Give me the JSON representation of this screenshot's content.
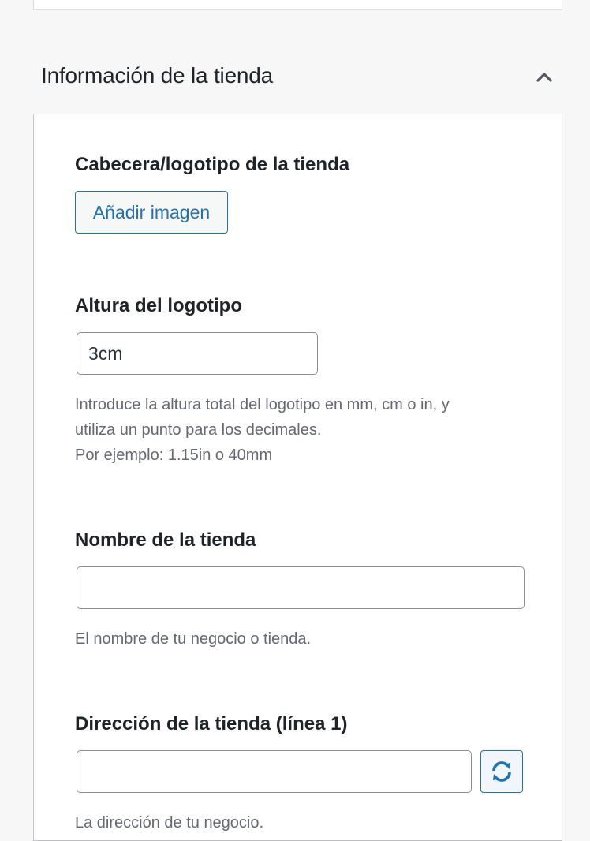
{
  "section": {
    "title": "Información de la tienda"
  },
  "fields": {
    "logo": {
      "label": "Cabecera/logotipo de la tienda",
      "button_label": "Añadir imagen"
    },
    "logo_height": {
      "label": "Altura del logotipo",
      "value": "3cm",
      "help_line1": "Introduce la altura total del logotipo en mm, cm o in, y",
      "help_line2": "utiliza un punto para los decimales.",
      "help_line3": "Por ejemplo: 1.15in o 40mm"
    },
    "shop_name": {
      "label": "Nombre de la tienda",
      "value": "",
      "help": "El nombre de tu negocio o tienda."
    },
    "shop_address_1": {
      "label": "Dirección de la tienda (línea 1)",
      "value": "",
      "help": "La dirección de tu negocio."
    }
  },
  "icons": {
    "collapse": "chevron-up-icon",
    "refresh": "refresh-icon"
  },
  "colors": {
    "accent": "#2271b1",
    "text": "#1d2327",
    "muted": "#646970",
    "border": "#c3c4c7"
  }
}
